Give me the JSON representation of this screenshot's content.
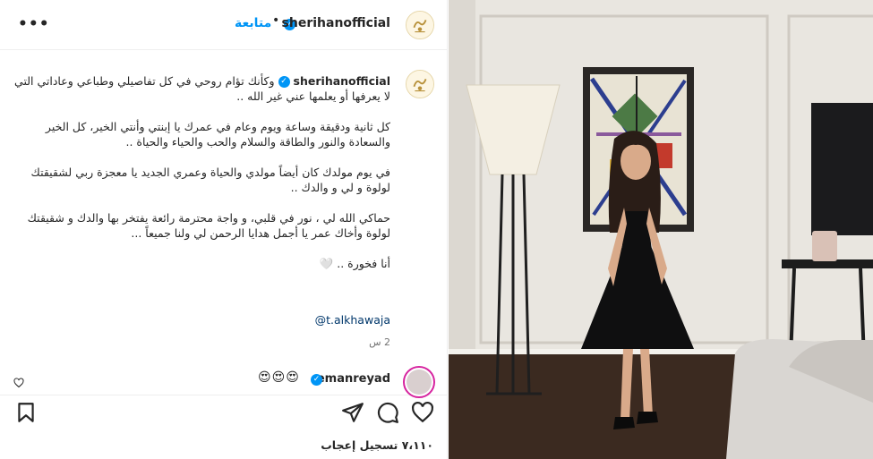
{
  "header": {
    "username": "sherihanofficial",
    "follow_label": "متابعة",
    "dot": "•",
    "more_icon": "more-horizontal-icon"
  },
  "caption": {
    "username": "sherihanofficial",
    "text": "وكأنك تؤام روحي في كل تفاصيلي وطباعي وعاداتي التي لا يعرفها أو يعلمها عني غير الله ..\n\nكل ثانية ودقيقة وساعة ويوم وعام في عمرك يا إبنتي وأنتي الخير، كل الخير والسعادة والنور والطاقة والسلام والحب والحياء والحياة ..\n\nفي يوم مولدك كان أيضاً مولدي والحياة وعمري الجديد يا معجزة ربي لشقيقتك لولوة و لي و والدك ..\n\nحماكي الله لي ، نور في قلبي، و واجة محترمة رائعة يفتخر بها والدك و شقيقتك لولوة وأخاك عمر يا أجمل هدايا الرحمن لي ولنا جميعاً ...\n\nأنا فخورة .. 🤍",
    "mention": "@t.alkhawaja",
    "timestamp": "2 س"
  },
  "comment": {
    "username": "emanreyad",
    "text": "😍😍😍"
  },
  "actions": {
    "likes_text": "٧،١١٠ تسجيل إعجاب"
  },
  "colors": {
    "accent": "#0095f6",
    "text": "#262626",
    "muted": "#737373",
    "mention": "#00376b"
  }
}
